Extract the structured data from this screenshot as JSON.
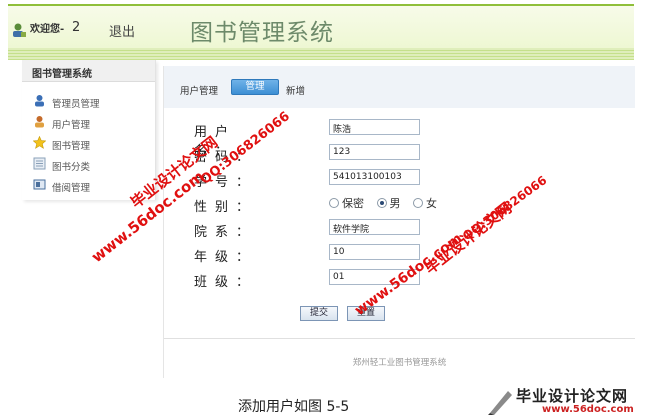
{
  "header": {
    "welcome": "欢迎您-",
    "user_number": "2",
    "logout": "退出",
    "title": "图书管理系统"
  },
  "sidebar": {
    "title": "图书管理系统",
    "items": [
      {
        "label": "管理员管理",
        "icon": "admin-user-icon"
      },
      {
        "label": "用户管理",
        "icon": "user-icon"
      },
      {
        "label": "图书管理",
        "icon": "star-icon"
      },
      {
        "label": "图书分类",
        "icon": "category-icon"
      },
      {
        "label": "借阅管理",
        "icon": "borrow-icon"
      }
    ]
  },
  "tabs": {
    "label": "用户管理",
    "active": "管理",
    "new": "新增"
  },
  "form": {
    "fields": [
      {
        "label": "用户名：",
        "value": "陈浩"
      },
      {
        "label": "密码：",
        "value": "123"
      },
      {
        "label": "学号：",
        "value": "541013100103"
      },
      {
        "label": "性别：",
        "options": [
          "保密",
          "男",
          "女"
        ],
        "selected": "男"
      },
      {
        "label": "院系：",
        "value": "软件学院"
      },
      {
        "label": "年级：",
        "value": "10"
      },
      {
        "label": "班级：",
        "value": "01"
      }
    ],
    "submit": "提交",
    "reset": "重置"
  },
  "footer": "郑州轻工业图书管理系统",
  "caption": "添加用户如图 5-5",
  "watermarks": {
    "site_a": "www.56doc.com",
    "qq_a": "QQ:306826066",
    "brand_a": "毕业设计论文网",
    "site_b": "www.56doc.com",
    "qq_b": "QQ:306826066",
    "brand_b": "毕业设计论文网",
    "logo_title": "毕业设计论文网",
    "logo_url": "www.56doc.com"
  },
  "colors": {
    "accent": "#3d8fd4",
    "header_green": "#8fbf3a",
    "watermark_red": "#e01010"
  }
}
